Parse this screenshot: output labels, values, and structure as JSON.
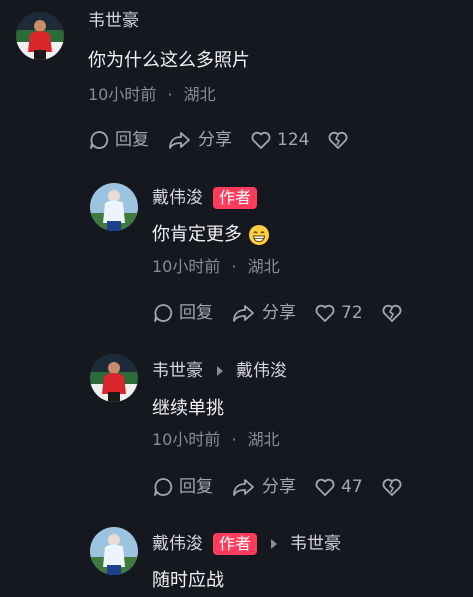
{
  "comments": [
    {
      "user": "韦世豪",
      "text": "你为什么这么多照片",
      "time": "10小时前",
      "location": "湖北",
      "reply_label": "回复",
      "share_label": "分享",
      "likes": "124"
    },
    {
      "user": "戴伟浚",
      "author_badge": "作者",
      "text": "你肯定更多",
      "emoji": "grinning-face-emoji",
      "time": "10小时前",
      "location": "湖北",
      "reply_label": "回复",
      "share_label": "分享",
      "likes": "72"
    },
    {
      "user": "韦世豪",
      "reply_to": "戴伟浚",
      "text": "继续单挑",
      "time": "10小时前",
      "location": "湖北",
      "reply_label": "回复",
      "share_label": "分享",
      "likes": "47"
    },
    {
      "user": "戴伟浚",
      "author_badge": "作者",
      "reply_to": "韦世豪",
      "text": "随时应战"
    }
  ],
  "separator": "·",
  "colors": {
    "background": "#16181f",
    "author_badge": "#ff3b5c",
    "secondary_text": "#8a8a92"
  }
}
